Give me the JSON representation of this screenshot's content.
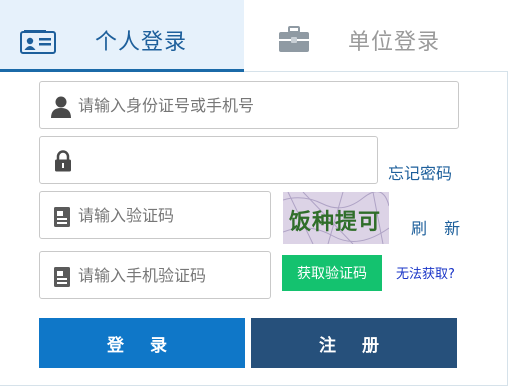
{
  "tabs": {
    "personal": {
      "label": "个人登录",
      "icon": "id-card-icon"
    },
    "unit": {
      "label": "单位登录",
      "icon": "briefcase-icon"
    }
  },
  "form": {
    "id_field": {
      "placeholder": "请输入身份证号或手机号",
      "value": "",
      "icon": "user-icon"
    },
    "password_field": {
      "placeholder": "",
      "value": "",
      "icon": "lock-icon"
    },
    "forgot_password": "忘记密码",
    "captcha_field": {
      "placeholder": "请输入验证码",
      "value": "",
      "icon": "card-icon"
    },
    "captcha_text": "饭种提可",
    "refresh": "刷 新",
    "sms_field": {
      "placeholder": "请输入手机验证码",
      "value": "",
      "icon": "card-icon"
    },
    "get_sms_code": "获取验证码",
    "cannot_get": "无法获取?"
  },
  "buttons": {
    "login": "登 录",
    "register": "注 册"
  },
  "colors": {
    "active_tab_bg": "#e6f1fb",
    "active_tab_text": "#1d5f9b",
    "login_button": "#0f77c8",
    "register_button": "#26507b",
    "sms_button": "#14c26f"
  }
}
